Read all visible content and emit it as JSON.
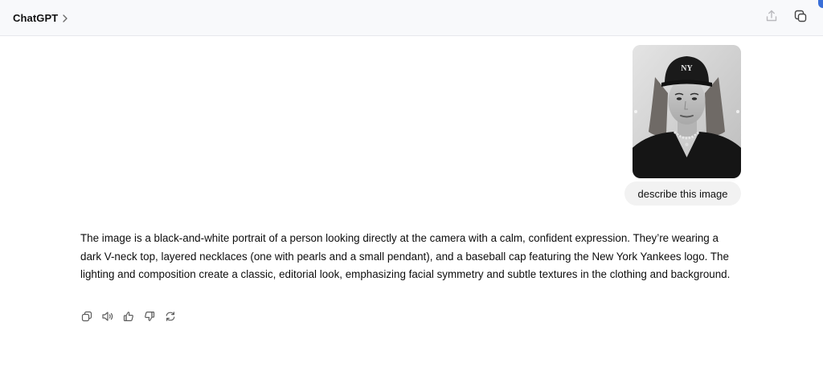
{
  "header": {
    "model_name": "ChatGPT",
    "chevron_icon": "chevron-right-icon",
    "share_icon": "share-upload-icon",
    "new_chat_icon": "new-chat-icon",
    "accent_color": "#3a6fd8"
  },
  "conversation": {
    "user_message": {
      "image": {
        "icon": "portrait-photo",
        "style": "black-and-white"
      },
      "text": "describe this image"
    },
    "assistant_message": {
      "text": "The image is a black-and-white portrait of a person looking directly at the camera with a calm, confident expression. They’re wearing a dark V-neck top, layered necklaces (one with pearls and a small pendant), and a baseball cap featuring the New York Yankees logo. The lighting and composition create a classic, editorial look, emphasizing facial symmetry and subtle textures in the clothing and background.",
      "actions": [
        {
          "name": "copy-icon"
        },
        {
          "name": "read-aloud-icon"
        },
        {
          "name": "thumbs-up-icon"
        },
        {
          "name": "thumbs-down-icon"
        },
        {
          "name": "regenerate-icon"
        }
      ]
    }
  }
}
